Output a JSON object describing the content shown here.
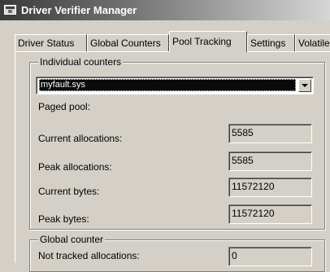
{
  "window": {
    "title": "Driver Verifier Manager"
  },
  "tabs": [
    {
      "label": "Driver Status"
    },
    {
      "label": "Global Counters"
    },
    {
      "label": "Pool Tracking"
    },
    {
      "label": "Settings"
    },
    {
      "label": "Volatile"
    }
  ],
  "individual": {
    "group_title": "Individual counters",
    "driver_selected": "myfault.sys",
    "paged_pool_label": "Paged pool:",
    "counters": [
      {
        "label": "Current allocations:",
        "value": "5585"
      },
      {
        "label": "Peak allocations:",
        "value": "5585"
      },
      {
        "label": "Current bytes:",
        "value": "11572120"
      },
      {
        "label": "Peak bytes:",
        "value": "11572120"
      }
    ]
  },
  "global": {
    "group_title": "Global counter",
    "counters": [
      {
        "label": "Not tracked allocations:",
        "value": "0"
      }
    ]
  }
}
